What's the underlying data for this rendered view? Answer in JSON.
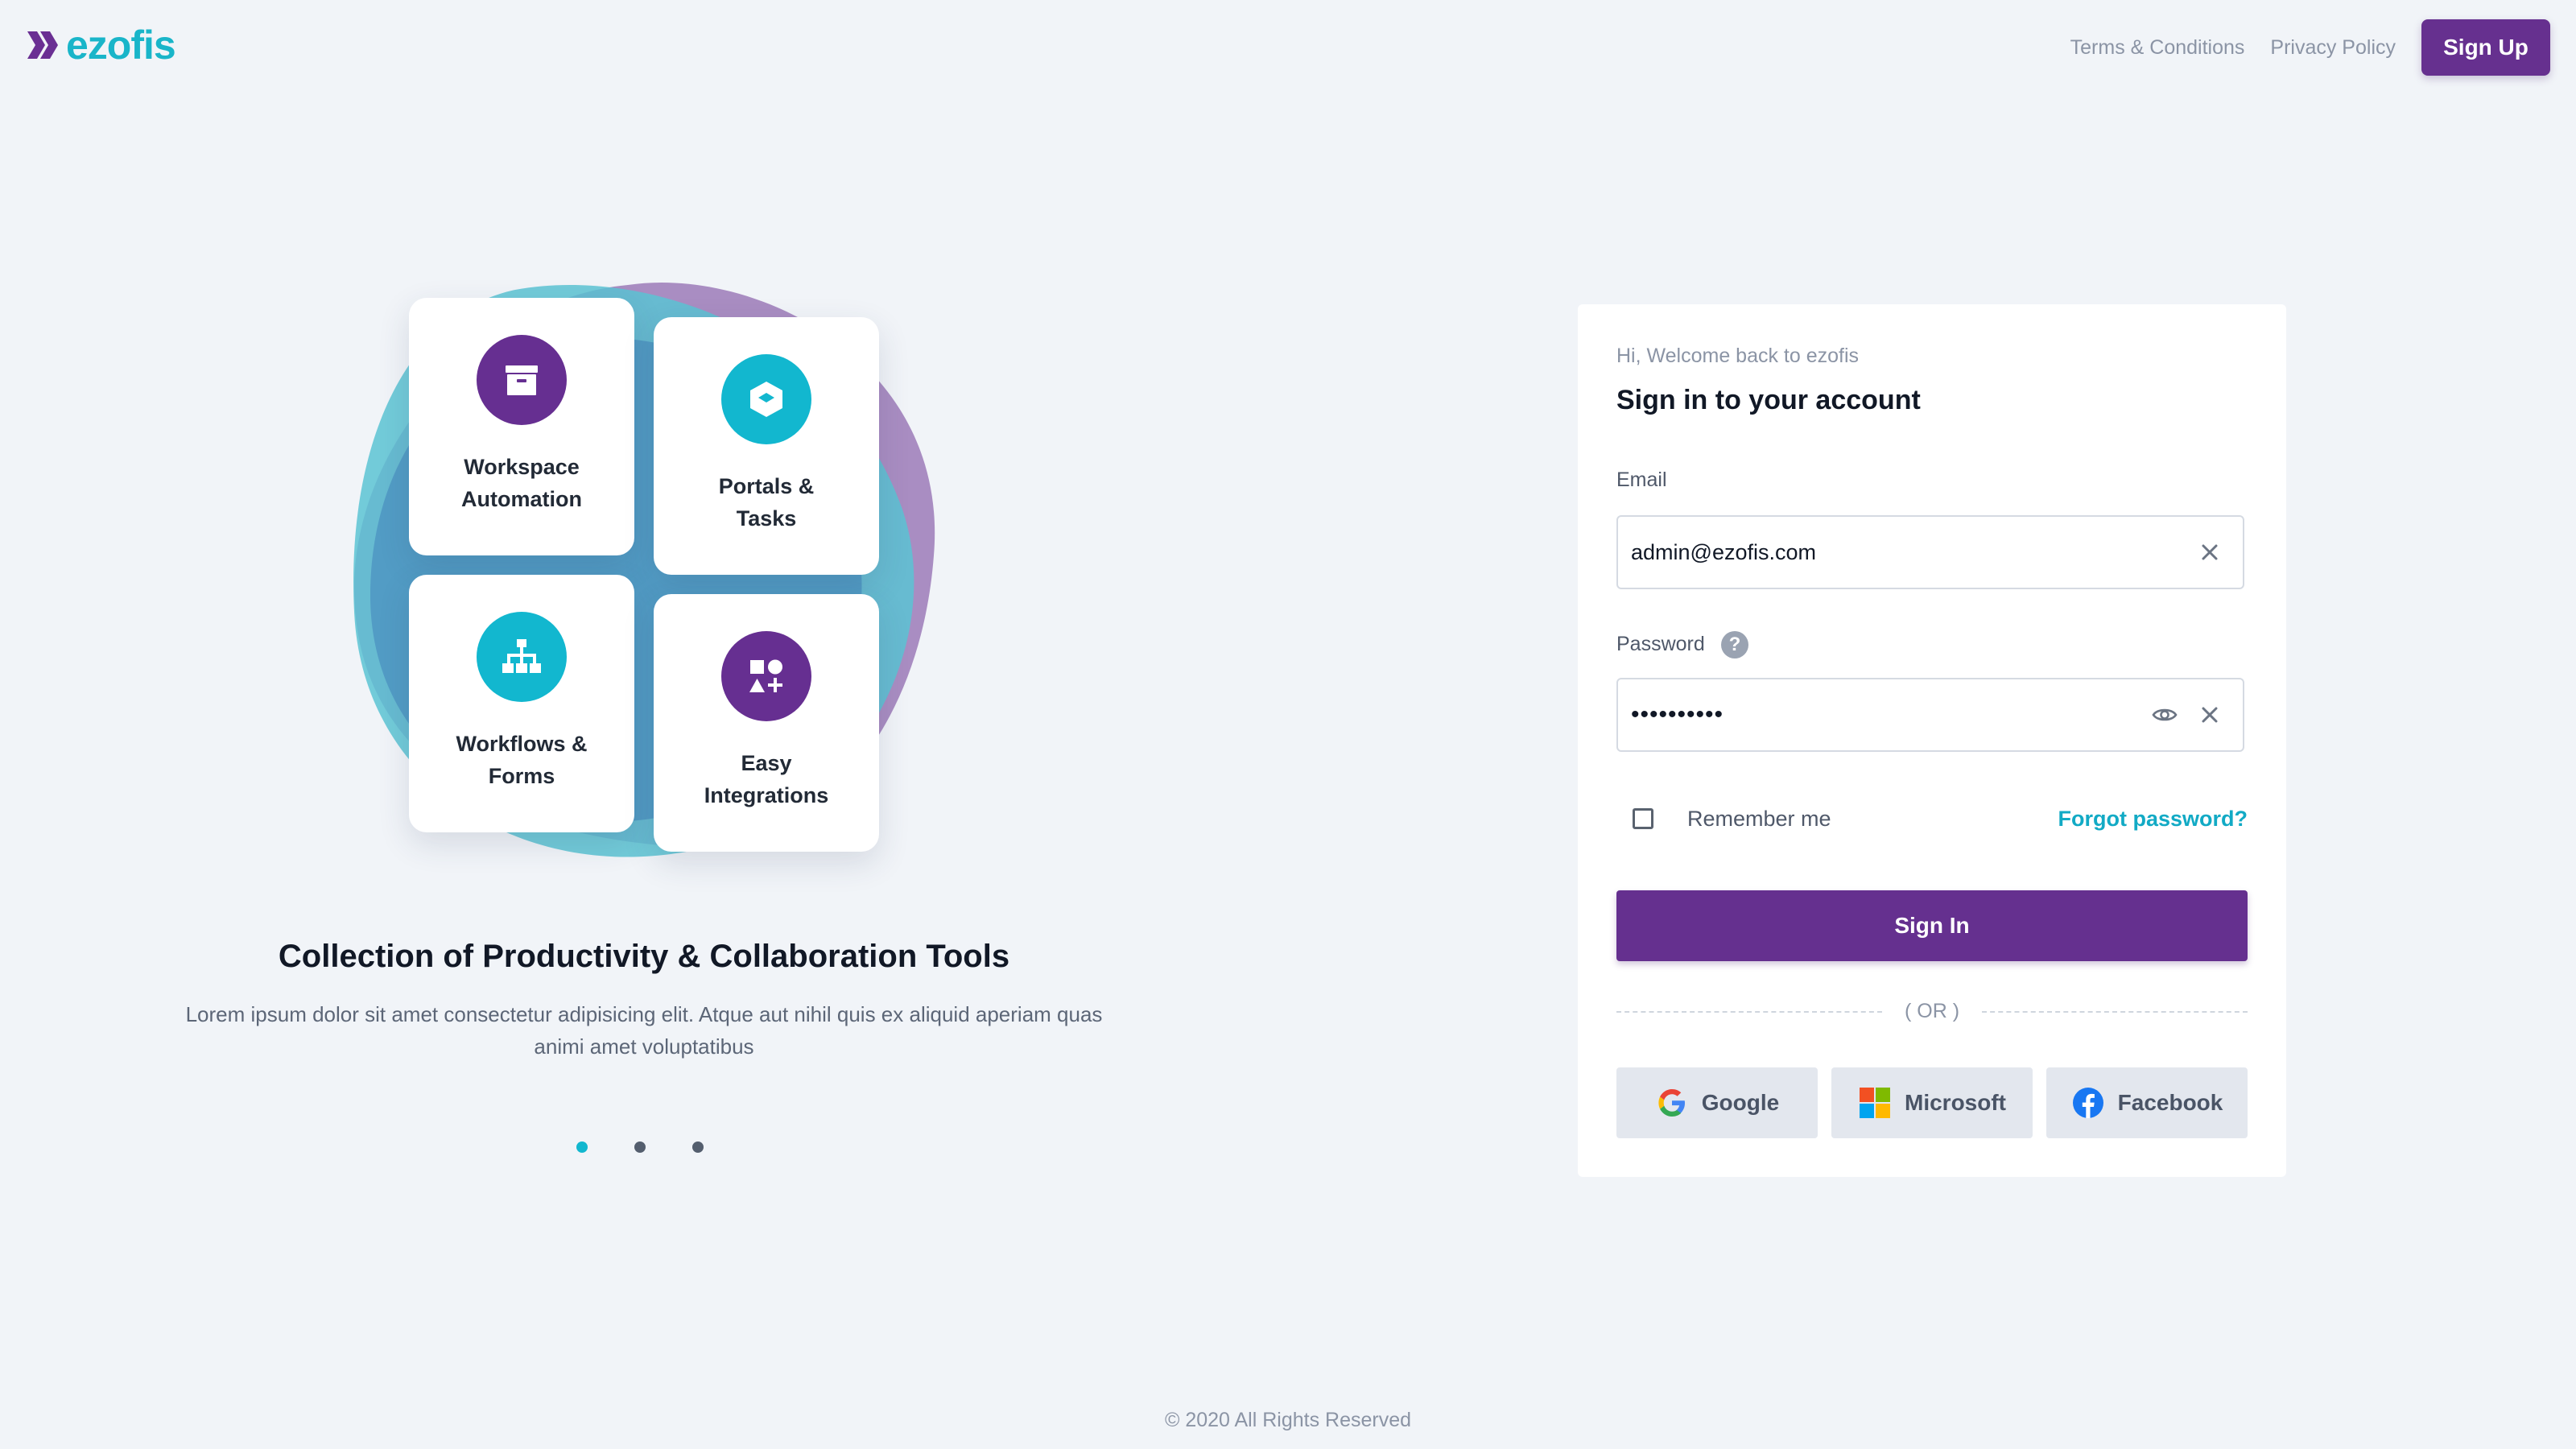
{
  "brand": {
    "name": "ezofis",
    "primary_color": "#66308f",
    "accent_color": "#12b7cf"
  },
  "header": {
    "links": [
      "Terms & Conditions",
      "Privacy Policy"
    ],
    "signup_label": "Sign Up"
  },
  "feature_tiles": [
    {
      "label": "Workspace\nAutomation",
      "icon": "archive-box-icon",
      "color": "#662f91"
    },
    {
      "label": "Portals &\nTasks",
      "icon": "cube-icon",
      "color": "#12b7cf"
    },
    {
      "label": "Workflows &\nForms",
      "icon": "hierarchy-icon",
      "color": "#12b7cf"
    },
    {
      "label": "Easy\nIntegrations",
      "icon": "shapes-icon",
      "color": "#662f91"
    }
  ],
  "promo": {
    "title": "Collection of Productivity & Collaboration Tools",
    "text": "Lorem ipsum dolor sit amet consectetur adipisicing elit. Atque aut nihil quis ex aliquid aperiam quas animi amet voluptatibus",
    "slides": 3,
    "active_slide": 1
  },
  "login": {
    "greeting": "Hi, Welcome back to ezofis",
    "title": "Sign in to your account",
    "email_label": "Email",
    "email_value": "admin@ezofis.com",
    "password_label": "Password",
    "password_value": "••••••••••",
    "remember_label": "Remember me",
    "remember_checked": false,
    "forgot_label": "Forgot password?",
    "signin_label": "Sign In",
    "or_label": "( OR )",
    "social": [
      "Google",
      "Microsoft",
      "Facebook"
    ]
  },
  "footer": "© 2020 All Rights Reserved"
}
